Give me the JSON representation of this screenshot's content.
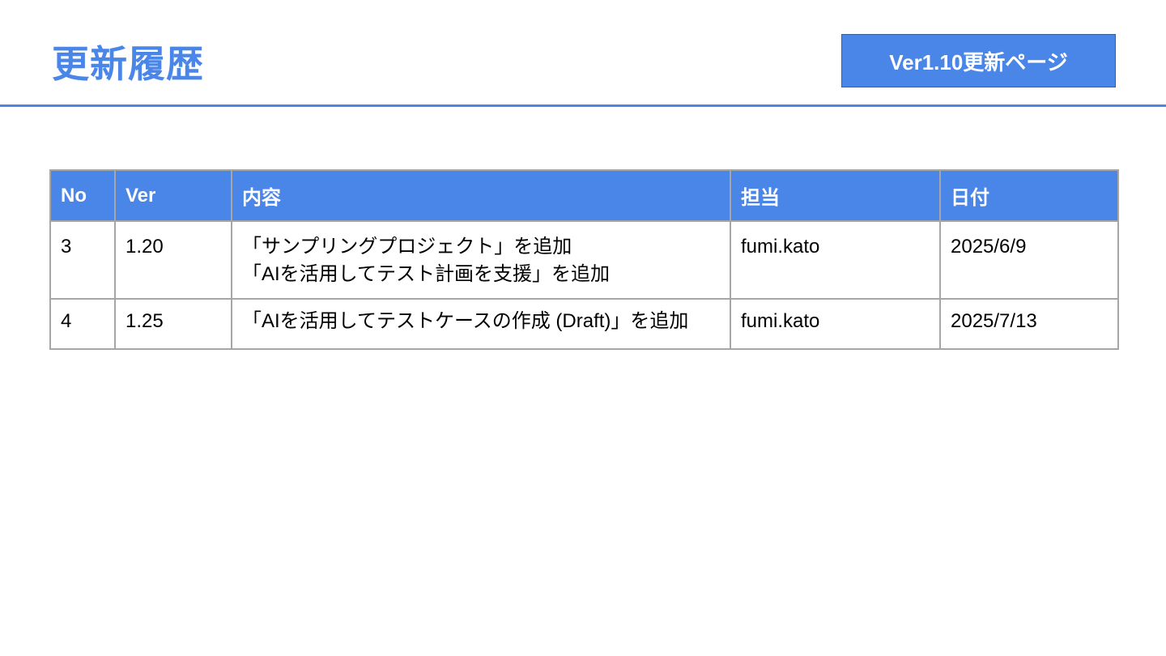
{
  "header": {
    "title": "更新履歴",
    "nav_button_label": "Ver1.10更新ページ"
  },
  "colors": {
    "accent": "#4a86e8",
    "table_border": "#a6a6a6",
    "header_text": "#ffffff"
  },
  "table": {
    "columns": [
      "No",
      "Ver",
      "内容",
      "担当",
      "日付"
    ],
    "rows": [
      {
        "no": "3",
        "ver": "1.20",
        "content": [
          "「サンプリングプロジェクト」を追加",
          "「AIを活用してテスト計画を支援」を追加"
        ],
        "owner": "fumi.kato",
        "date": "2025/6/9"
      },
      {
        "no": "4",
        "ver": "1.25",
        "content": [
          "「AIを活用してテストケースの作成 (Draft)」を追加"
        ],
        "owner": "fumi.kato",
        "date": "2025/7/13"
      }
    ]
  }
}
